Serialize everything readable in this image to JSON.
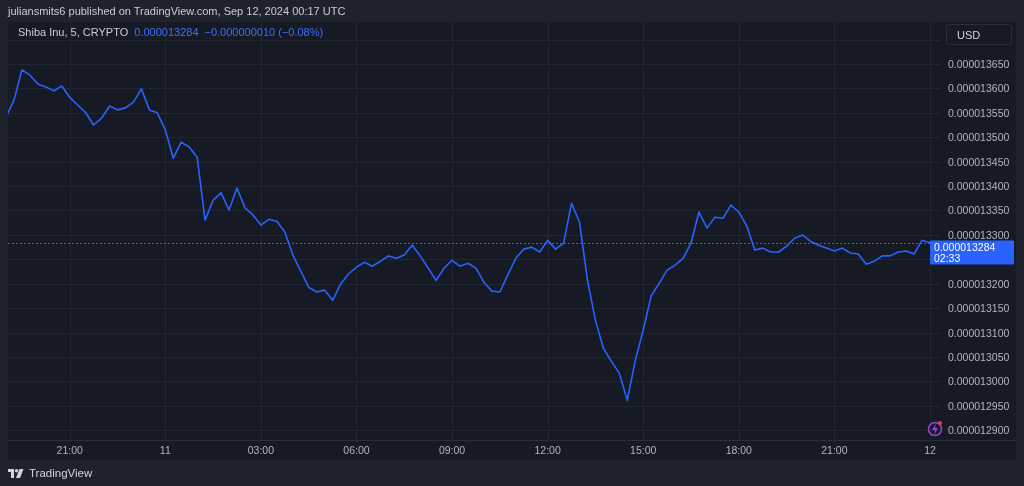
{
  "header": {
    "text": "juliansmits6 published on TradingView.com, Sep 12, 2024 00:17 UTC"
  },
  "chart": {
    "legend": {
      "symbol": "Shiba Inu, 5, CRYPTO",
      "price": "0.000013284",
      "change": "−0.000000010 (−0.08%)"
    },
    "currency_button": "USD",
    "last_price_label": {
      "countdown": "02:33"
    },
    "chart_data": {
      "type": "line",
      "categories": [
        null,
        null,
        null,
        null,
        null,
        null,
        null,
        null,
        "21:00",
        null,
        null,
        null,
        null,
        null,
        null,
        null,
        null,
        null,
        null,
        null,
        "11",
        null,
        null,
        null,
        null,
        null,
        null,
        null,
        null,
        null,
        null,
        null,
        "03:00",
        null,
        null,
        null,
        null,
        null,
        null,
        null,
        null,
        null,
        null,
        null,
        "06:00",
        null,
        null,
        null,
        null,
        null,
        null,
        null,
        null,
        null,
        null,
        null,
        "09:00",
        null,
        null,
        null,
        null,
        null,
        null,
        null,
        null,
        null,
        null,
        null,
        "12:00",
        null,
        null,
        null,
        null,
        null,
        null,
        null,
        null,
        null,
        null,
        null,
        "15:00",
        null,
        null,
        null,
        null,
        null,
        null,
        null,
        null,
        null,
        null,
        null,
        "18:00",
        null,
        null,
        null,
        null,
        null,
        null,
        null,
        null,
        null,
        null,
        null,
        "21:00",
        null,
        null,
        null,
        null,
        null,
        null,
        null,
        null,
        null,
        null,
        null,
        "12"
      ],
      "series": [
        {
          "color": "#2962ff",
          "values": [
            1.3541e-05,
            1.3576e-05,
            1.3638e-05,
            1.3627e-05,
            1.3609e-05,
            1.3603e-05,
            1.3595e-05,
            1.3605e-05,
            1.3582e-05,
            1.3566e-05,
            1.355e-05,
            1.3525e-05,
            1.3539e-05,
            1.3564e-05,
            1.3556e-05,
            1.356e-05,
            1.3572e-05,
            1.3599e-05,
            1.3556e-05,
            1.355e-05,
            1.3515e-05,
            1.3457e-05,
            1.349e-05,
            1.348e-05,
            1.3459e-05,
            1.333e-05,
            1.3371e-05,
            1.3386e-05,
            1.3351e-05,
            1.3396e-05,
            1.3355e-05,
            1.3341e-05,
            1.332e-05,
            1.3332e-05,
            1.3328e-05,
            1.3306e-05,
            1.3259e-05,
            1.3226e-05,
            1.3193e-05,
            1.3183e-05,
            1.3187e-05,
            1.3166e-05,
            1.3199e-05,
            1.322e-05,
            1.3234e-05,
            1.3244e-05,
            1.3236e-05,
            1.3246e-05,
            1.3257e-05,
            1.3252e-05,
            1.3259e-05,
            1.3279e-05,
            1.3257e-05,
            1.3232e-05,
            1.3207e-05,
            1.3232e-05,
            1.3248e-05,
            1.3236e-05,
            1.3242e-05,
            1.3232e-05,
            1.3203e-05,
            1.3185e-05,
            1.3183e-05,
            1.3218e-05,
            1.3252e-05,
            1.3271e-05,
            1.3275e-05,
            1.3265e-05,
            1.3289e-05,
            1.3271e-05,
            1.3283e-05,
            1.3365e-05,
            1.3326e-05,
            1.3207e-05,
            1.3125e-05,
            1.3068e-05,
            1.3041e-05,
            1.3017e-05,
            1.2961e-05,
            1.3043e-05,
            1.3105e-05,
            1.3175e-05,
            1.3201e-05,
            1.3228e-05,
            1.3238e-05,
            1.3252e-05,
            1.3283e-05,
            1.3347e-05,
            1.3314e-05,
            1.3336e-05,
            1.3334e-05,
            1.3361e-05,
            1.3347e-05,
            1.3318e-05,
            1.3269e-05,
            1.3273e-05,
            1.3265e-05,
            1.3265e-05,
            1.3277e-05,
            1.3293e-05,
            1.33e-05,
            1.3287e-05,
            1.3279e-05,
            1.3273e-05,
            1.3267e-05,
            1.3273e-05,
            1.3263e-05,
            1.3261e-05,
            1.324e-05,
            1.3246e-05,
            1.3257e-05,
            1.3257e-05,
            1.3265e-05,
            1.3267e-05,
            1.3261e-05,
            1.3289e-05,
            1.3284e-05
          ]
        }
      ],
      "ylim": [
        1.288e-05,
        1.3736e-05
      ],
      "grid": true,
      "ref_lines": [
        {
          "axis": "y",
          "value": 1.3284e-05,
          "label": "0.000013284",
          "color": "#2962ff"
        }
      ],
      "yticks": [
        {
          "value": 1.365e-05,
          "label": "0.000013650"
        },
        {
          "value": 1.36e-05,
          "label": "0.000013600"
        },
        {
          "value": 1.355e-05,
          "label": "0.000013550"
        },
        {
          "value": 1.35e-05,
          "label": "0.000013500"
        },
        {
          "value": 1.345e-05,
          "label": "0.000013450"
        },
        {
          "value": 1.34e-05,
          "label": "0.000013400"
        },
        {
          "value": 1.335e-05,
          "label": "0.000013350"
        },
        {
          "value": 1.33e-05,
          "label": "0.000013300"
        },
        {
          "value": 1.32e-05,
          "label": "0.000013200"
        },
        {
          "value": 1.315e-05,
          "label": "0.000013150"
        },
        {
          "value": 1.31e-05,
          "label": "0.000013100"
        },
        {
          "value": 1.305e-05,
          "label": "0.000013050"
        },
        {
          "value": 1.3e-05,
          "label": "0.000013000"
        },
        {
          "value": 1.295e-05,
          "label": "0.000012950"
        },
        {
          "value": 1.29e-05,
          "label": "0.000012900"
        }
      ]
    }
  },
  "footer": {
    "brand": "TradingView"
  }
}
